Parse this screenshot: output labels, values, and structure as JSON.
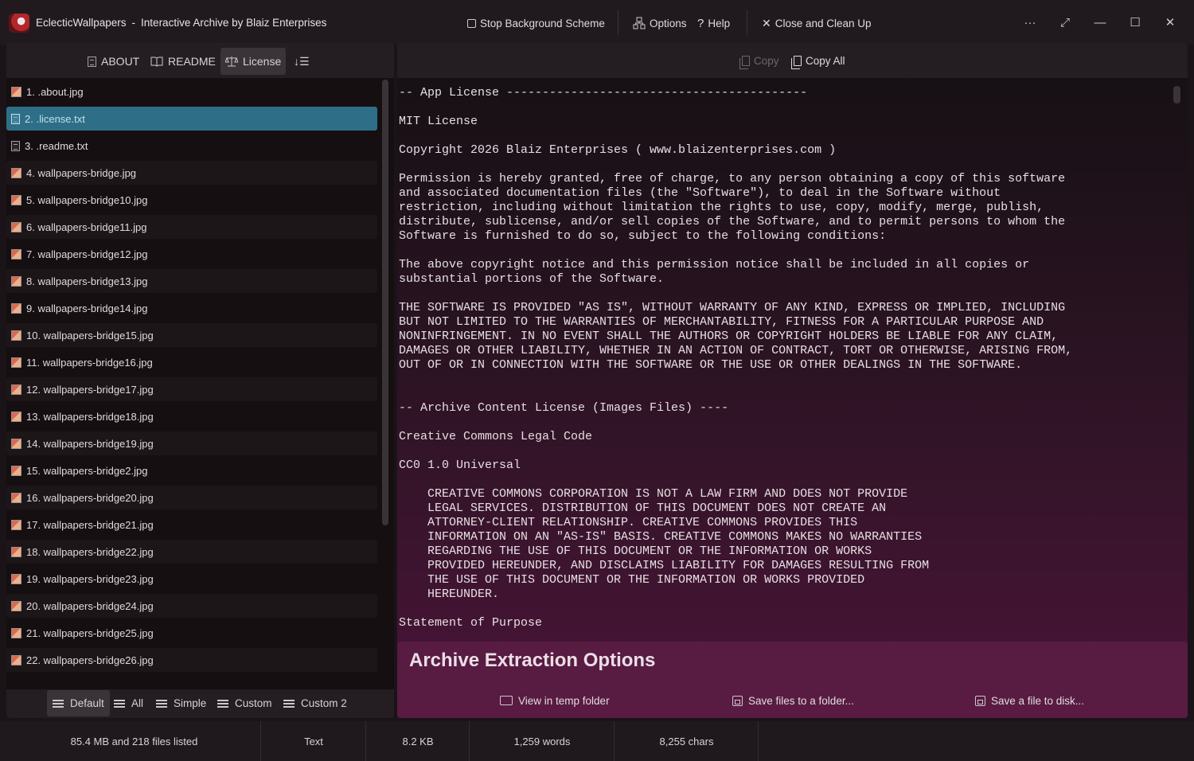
{
  "window": {
    "app_name": "EclecticWallpapers",
    "separator": "-",
    "subtitle": "Interactive Archive by Blaiz Enterprises"
  },
  "titlebar": {
    "stop_bg": "Stop Background Scheme",
    "options": "Options",
    "help": "Help",
    "close_clean": "Close and Clean Up",
    "more": "···",
    "expand": "⤢",
    "minimize": "—",
    "maximize": "☐",
    "close": "✕"
  },
  "left_toolbar": {
    "about": "ABOUT",
    "readme": "README",
    "license": "License",
    "sort": "↓☰"
  },
  "files": [
    {
      "label": "1. .about.jpg",
      "type": "jpg"
    },
    {
      "label": "2. .license.txt",
      "type": "txt",
      "selected": true
    },
    {
      "label": "3. .readme.txt",
      "type": "txt"
    },
    {
      "label": "4. wallpapers-bridge.jpg",
      "type": "jpg"
    },
    {
      "label": "5. wallpapers-bridge10.jpg",
      "type": "jpg"
    },
    {
      "label": "6. wallpapers-bridge11.jpg",
      "type": "jpg"
    },
    {
      "label": "7. wallpapers-bridge12.jpg",
      "type": "jpg"
    },
    {
      "label": "8. wallpapers-bridge13.jpg",
      "type": "jpg"
    },
    {
      "label": "9. wallpapers-bridge14.jpg",
      "type": "jpg"
    },
    {
      "label": "10. wallpapers-bridge15.jpg",
      "type": "jpg"
    },
    {
      "label": "11. wallpapers-bridge16.jpg",
      "type": "jpg"
    },
    {
      "label": "12. wallpapers-bridge17.jpg",
      "type": "jpg"
    },
    {
      "label": "13. wallpapers-bridge18.jpg",
      "type": "jpg"
    },
    {
      "label": "14. wallpapers-bridge19.jpg",
      "type": "jpg"
    },
    {
      "label": "15. wallpapers-bridge2.jpg",
      "type": "jpg"
    },
    {
      "label": "16. wallpapers-bridge20.jpg",
      "type": "jpg"
    },
    {
      "label": "17. wallpapers-bridge21.jpg",
      "type": "jpg"
    },
    {
      "label": "18. wallpapers-bridge22.jpg",
      "type": "jpg"
    },
    {
      "label": "19. wallpapers-bridge23.jpg",
      "type": "jpg"
    },
    {
      "label": "20. wallpapers-bridge24.jpg",
      "type": "jpg"
    },
    {
      "label": "21. wallpapers-bridge25.jpg",
      "type": "jpg"
    },
    {
      "label": "22. wallpapers-bridge26.jpg",
      "type": "jpg"
    }
  ],
  "left_bottom": {
    "default": "Default",
    "all": "All",
    "simple": "Simple",
    "custom": "Custom",
    "custom2": "Custom 2"
  },
  "right_toolbar": {
    "copy": "Copy",
    "copy_all": "Copy All"
  },
  "license_lines": [
    "-- App License ------------------------------------------",
    "",
    "MIT License",
    "",
    "Copyright 2026 Blaiz Enterprises ( www.blaizenterprises.com )",
    "",
    "Permission is hereby granted, free of charge, to any person obtaining a copy of this software",
    "and associated documentation files (the \"Software\"), to deal in the Software without",
    "restriction, including without limitation the rights to use, copy, modify, merge, publish,",
    "distribute, sublicense, and/or sell copies of the Software, and to permit persons to whom the",
    "Software is furnished to do so, subject to the following conditions:",
    "",
    "The above copyright notice and this permission notice shall be included in all copies or",
    "substantial portions of the Software.",
    "",
    "THE SOFTWARE IS PROVIDED \"AS IS\", WITHOUT WARRANTY OF ANY KIND, EXPRESS OR IMPLIED, INCLUDING",
    "BUT NOT LIMITED TO THE WARRANTIES OF MERCHANTABILITY, FITNESS FOR A PARTICULAR PURPOSE AND",
    "NONINFRINGEMENT. IN NO EVENT SHALL THE AUTHORS OR COPYRIGHT HOLDERS BE LIABLE FOR ANY CLAIM,",
    "DAMAGES OR OTHER LIABILITY, WHETHER IN AN ACTION OF CONTRACT, TORT OR OTHERWISE, ARISING FROM,",
    "OUT OF OR IN CONNECTION WITH THE SOFTWARE OR THE USE OR OTHER DEALINGS IN THE SOFTWARE.",
    "",
    "",
    "-- Archive Content License (Images Files) ----",
    "",
    "Creative Commons Legal Code",
    "",
    "CC0 1.0 Universal",
    "",
    "    CREATIVE COMMONS CORPORATION IS NOT A LAW FIRM AND DOES NOT PROVIDE",
    "    LEGAL SERVICES. DISTRIBUTION OF THIS DOCUMENT DOES NOT CREATE AN",
    "    ATTORNEY-CLIENT RELATIONSHIP. CREATIVE COMMONS PROVIDES THIS",
    "    INFORMATION ON AN \"AS-IS\" BASIS. CREATIVE COMMONS MAKES NO WARRANTIES",
    "    REGARDING THE USE OF THIS DOCUMENT OR THE INFORMATION OR WORKS",
    "    PROVIDED HEREUNDER, AND DISCLAIMS LIABILITY FOR DAMAGES RESULTING FROM",
    "    THE USE OF THIS DOCUMENT OR THE INFORMATION OR WORKS PROVIDED",
    "    HEREUNDER.",
    "",
    "Statement of Purpose"
  ],
  "extract": {
    "title": "Archive Extraction Options",
    "view_temp": "View in temp folder",
    "save_folder": "Save files to a folder...",
    "save_disk": "Save a file to disk..."
  },
  "status": {
    "summary": "85.4 MB and 218 files listed",
    "type": "Text",
    "size": "8.2 KB",
    "words": "1,259 words",
    "chars": "8,255 chars"
  },
  "colors": {
    "selected_row": "#2e6f87",
    "accent_panel": "#5c1c44"
  }
}
